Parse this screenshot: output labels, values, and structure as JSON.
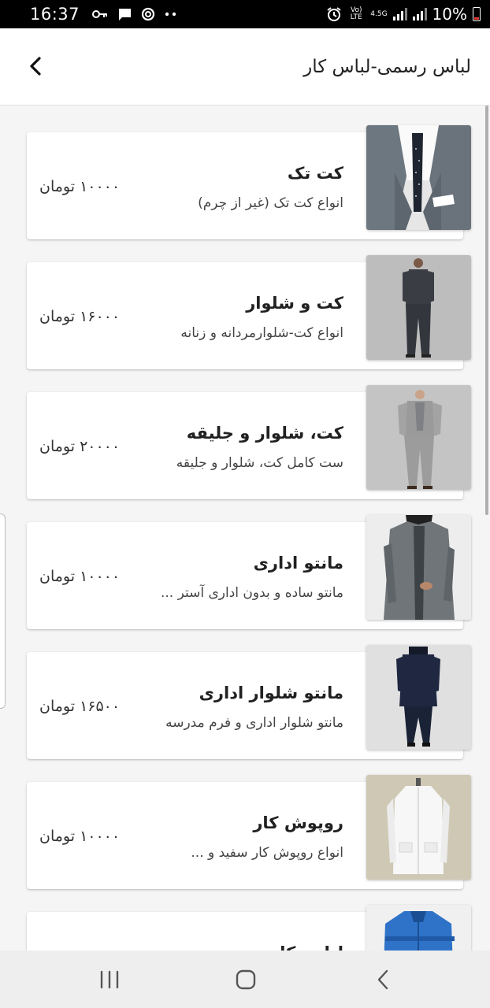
{
  "status_bar": {
    "time": "16:37",
    "network_type": "4.5G",
    "volte_label": "Vo) LTE",
    "battery_percent": "10%",
    "icons": [
      "key-icon",
      "chat-icon",
      "sync-icon",
      "more-dots-icon",
      "alarm-icon",
      "signal-icon",
      "battery-icon"
    ]
  },
  "app_bar": {
    "title": "لباس رسمی-لباس کار",
    "back_icon": "chevron-left-icon"
  },
  "products": [
    {
      "title": "کت تک",
      "description": "انواع کت تک (غیر از چرم)",
      "price": "۱۰۰۰۰ تومان",
      "image": "grey-blazer-closeup"
    },
    {
      "title": "کت و شلوار",
      "description": "انواع کت-شلوارمردانه و  زنانه",
      "price": "۱۶۰۰۰ تومان",
      "image": "dark-plaid-suit"
    },
    {
      "title": "کت، شلوار و جلیقه",
      "description": "ست کامل کت، شلوار و جلیقه",
      "price": "۲۰۰۰۰ تومان",
      "image": "grey-three-piece-suit"
    },
    {
      "title": "مانتو  اداری",
      "description": "مانتو ساده و بدون  اداری آستر ...",
      "price": "۱۰۰۰۰ تومان",
      "image": "grey-office-manteau"
    },
    {
      "title": "مانتو شلوار اداری",
      "description": "مانتو شلوار اداری و فرم مدرسه",
      "price": "۱۶۵۰۰ تومان",
      "image": "navy-manteau-pants"
    },
    {
      "title": "روپوش کار",
      "description": "انواع روپوش کار سفید و ...",
      "price": "۱۰۰۰۰ تومان",
      "image": "white-work-coat"
    },
    {
      "title": "لباس کار",
      "description": "",
      "price": "",
      "image": "blue-work-jacket"
    }
  ],
  "nav_bar": {
    "buttons": [
      "recent-apps-icon",
      "home-icon",
      "back-icon"
    ]
  }
}
